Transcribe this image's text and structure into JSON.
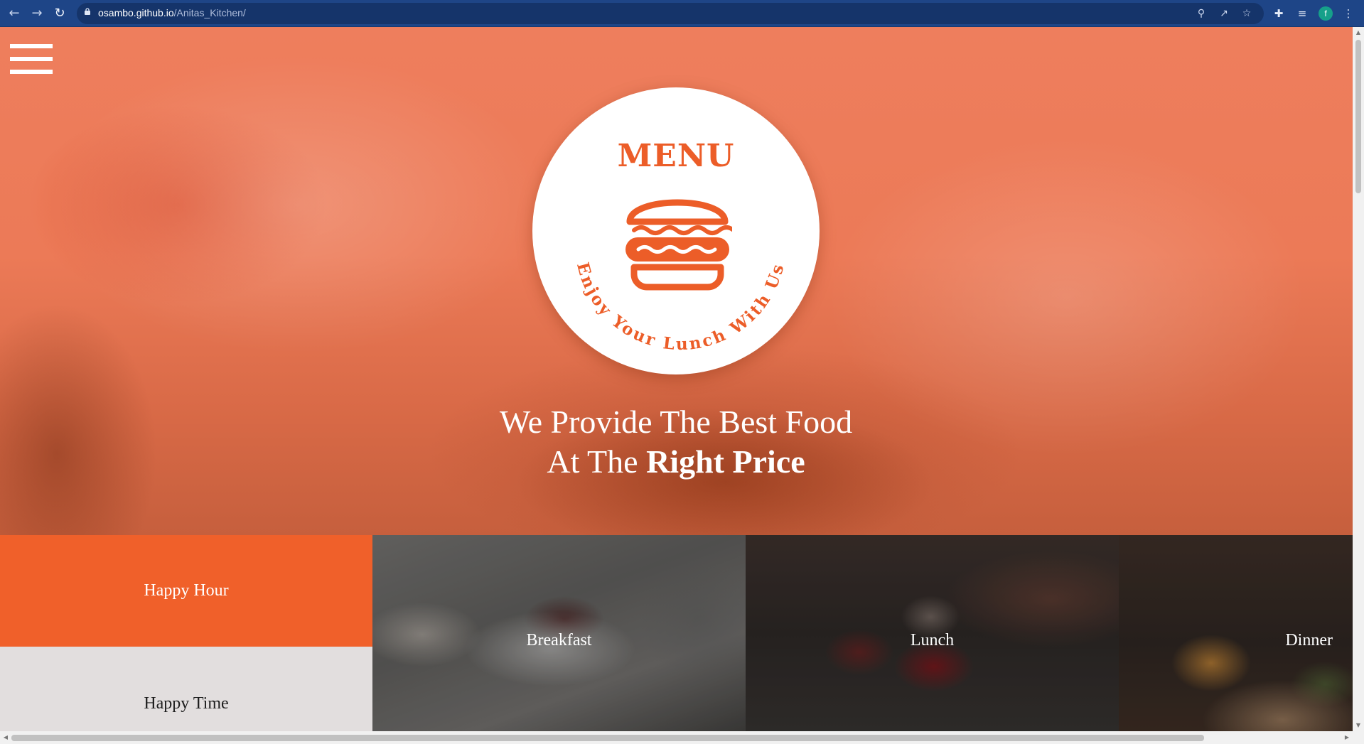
{
  "browser": {
    "url_host": "osambo.github.io",
    "url_path": "/Anitas_Kitchen/",
    "profile_initial": "f"
  },
  "logo": {
    "title": "MENU",
    "arc_text": "Enjoy Your Lunch With Us"
  },
  "hero": {
    "line1": "We Provide The Best Food",
    "line2_prefix": "At The ",
    "line2_bold": "Right Price"
  },
  "tiles": {
    "happy_hour": "Happy Hour",
    "happy_time": "Happy Time",
    "breakfast": "Breakfast",
    "lunch": "Lunch",
    "dinner": "Dinner"
  },
  "colors": {
    "accent_orange": "#f0602a",
    "logo_orange": "#ec5d28",
    "chrome_blue": "#1e4587"
  },
  "icons": [
    "back-icon",
    "forward-icon",
    "reload-icon",
    "lock-icon",
    "zoom-icon",
    "share-icon",
    "star-icon",
    "extensions-icon",
    "reading-list-icon",
    "menu-dots-icon",
    "hamburger-icon",
    "burger-icon"
  ]
}
